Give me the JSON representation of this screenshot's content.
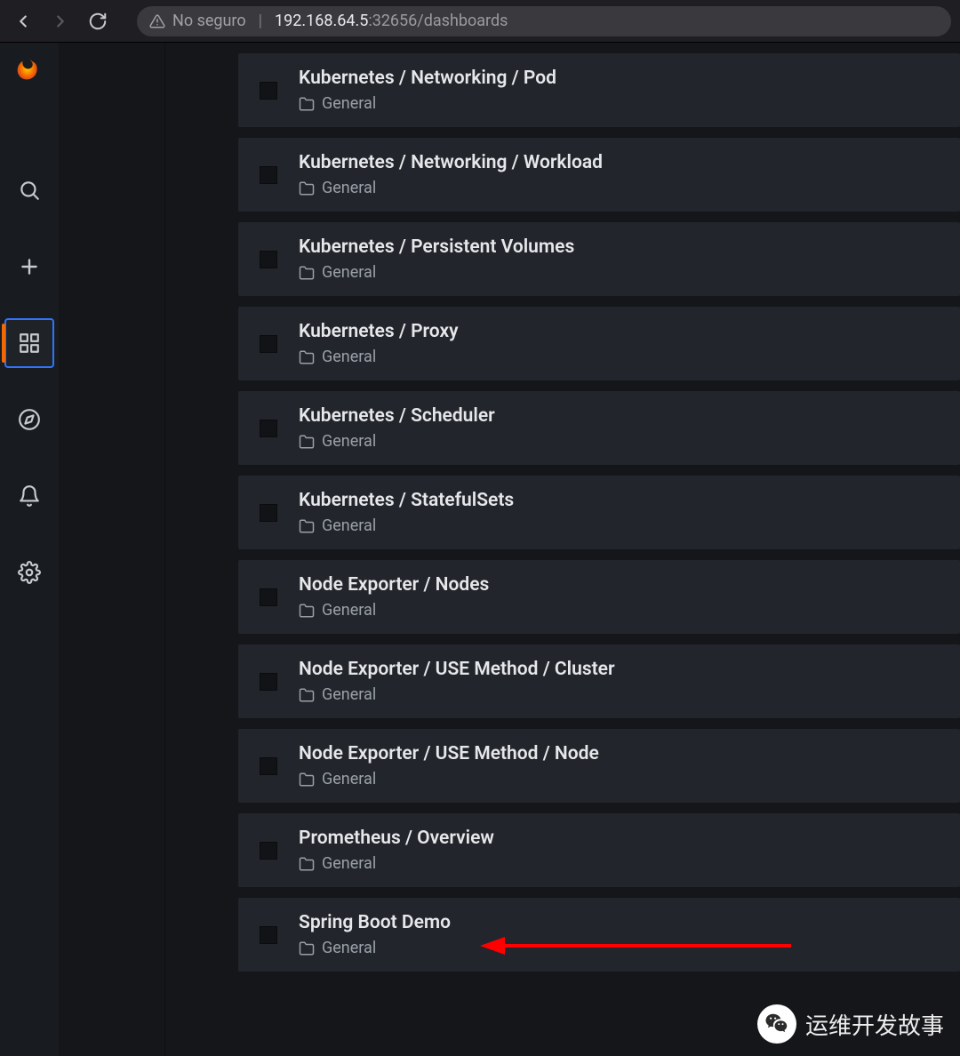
{
  "browser": {
    "insecure_label": "No seguro",
    "url_host": "192.168.64.5",
    "url_port_path": ":32656/dashboards"
  },
  "sidebar": {
    "items": [
      {
        "name": "search"
      },
      {
        "name": "create"
      },
      {
        "name": "dashboards",
        "active": true
      },
      {
        "name": "explore"
      },
      {
        "name": "alerting"
      },
      {
        "name": "configuration"
      }
    ]
  },
  "dashboards": [
    {
      "title": "Kubernetes / Networking / Pod",
      "folder": "General"
    },
    {
      "title": "Kubernetes / Networking / Workload",
      "folder": "General"
    },
    {
      "title": "Kubernetes / Persistent Volumes",
      "folder": "General"
    },
    {
      "title": "Kubernetes / Proxy",
      "folder": "General"
    },
    {
      "title": "Kubernetes / Scheduler",
      "folder": "General"
    },
    {
      "title": "Kubernetes / StatefulSets",
      "folder": "General"
    },
    {
      "title": "Node Exporter / Nodes",
      "folder": "General"
    },
    {
      "title": "Node Exporter / USE Method / Cluster",
      "folder": "General"
    },
    {
      "title": "Node Exporter / USE Method / Node",
      "folder": "General"
    },
    {
      "title": "Prometheus / Overview",
      "folder": "General"
    },
    {
      "title": "Spring Boot Demo",
      "folder": "General"
    }
  ],
  "watermark": {
    "text": "运维开发故事"
  }
}
